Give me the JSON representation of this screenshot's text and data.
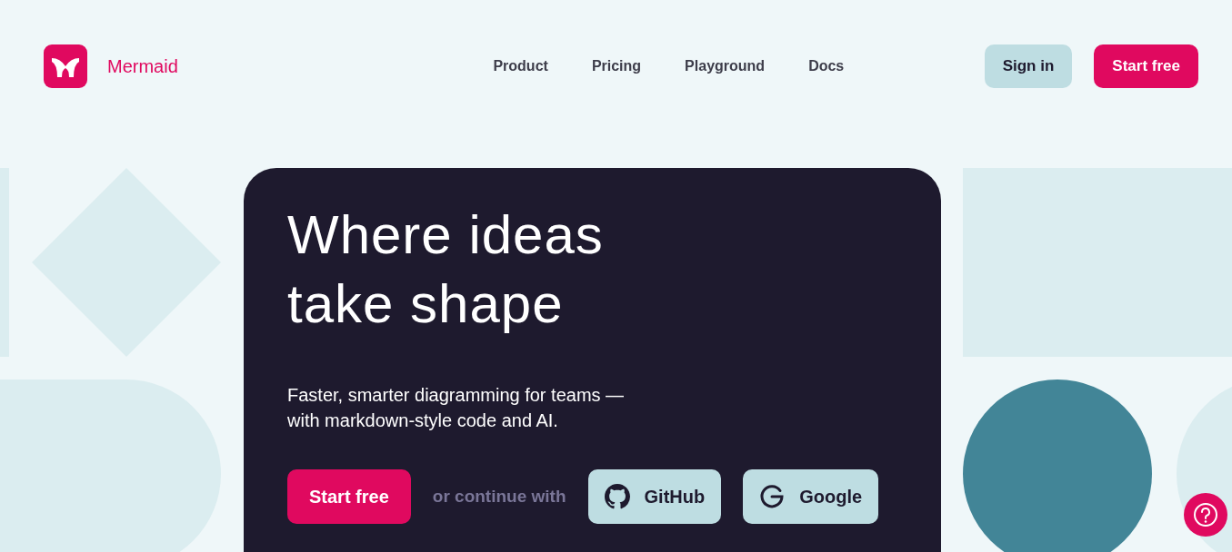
{
  "header": {
    "brand": "Mermaid",
    "nav": [
      {
        "label": "Product"
      },
      {
        "label": "Pricing"
      },
      {
        "label": "Playground"
      },
      {
        "label": "Docs"
      }
    ],
    "sign_in": "Sign in",
    "start_free": "Start free"
  },
  "hero": {
    "title_lines": [
      "Where ideas",
      "take shape"
    ],
    "subtitle_lines": [
      "Faster, smarter diagramming for teams —",
      "with markdown-style code and AI."
    ],
    "cta": "Start free",
    "or_text": "or continue with",
    "providers": [
      {
        "kind": "github",
        "label": "GitHub"
      },
      {
        "kind": "google",
        "label": "Google"
      }
    ]
  },
  "help_button": {
    "kind": "help"
  }
}
